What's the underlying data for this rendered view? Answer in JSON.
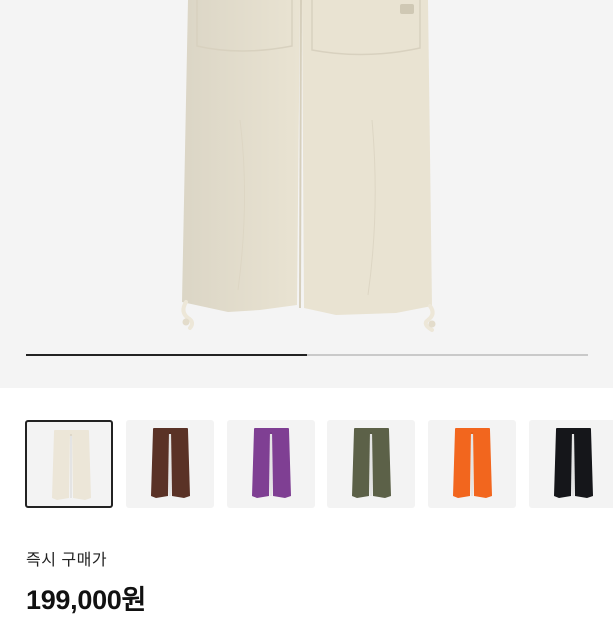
{
  "gallery": {
    "progress_fraction": 0.5,
    "thumbnails": [
      {
        "color": "#ece6d8",
        "selected": true
      },
      {
        "color": "#5a3226",
        "selected": false
      },
      {
        "color": "#7f3f93",
        "selected": false
      },
      {
        "color": "#5c6148",
        "selected": false
      },
      {
        "color": "#f2661e",
        "selected": false
      },
      {
        "color": "#15161a",
        "selected": false
      }
    ]
  },
  "product": {
    "main_color": "#e9e3d2",
    "price_label": "즉시 구매가",
    "price": "199,000원"
  }
}
